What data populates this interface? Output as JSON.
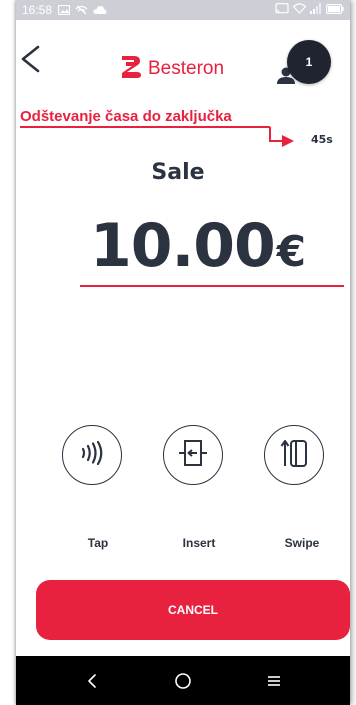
{
  "status_bar": {
    "time": "16:58"
  },
  "header": {
    "brand_name": "Besteron",
    "notification_count": "1"
  },
  "annotation": {
    "text": "Odštevanje časa do zaključka",
    "countdown": "45s"
  },
  "transaction": {
    "type_label": "Sale",
    "amount": "10.00",
    "currency": "€"
  },
  "payment_methods": [
    {
      "label": "Tap",
      "icon": "contactless-icon"
    },
    {
      "label": "Insert",
      "icon": "card-insert-icon"
    },
    {
      "label": "Swipe",
      "icon": "card-swipe-icon"
    }
  ],
  "actions": {
    "cancel_label": "CANCEL"
  },
  "colors": {
    "brand_red": "#e8213e",
    "text_dark": "#2b3240",
    "status_bar": "#ccd0d6",
    "nav_bar": "#000000"
  }
}
